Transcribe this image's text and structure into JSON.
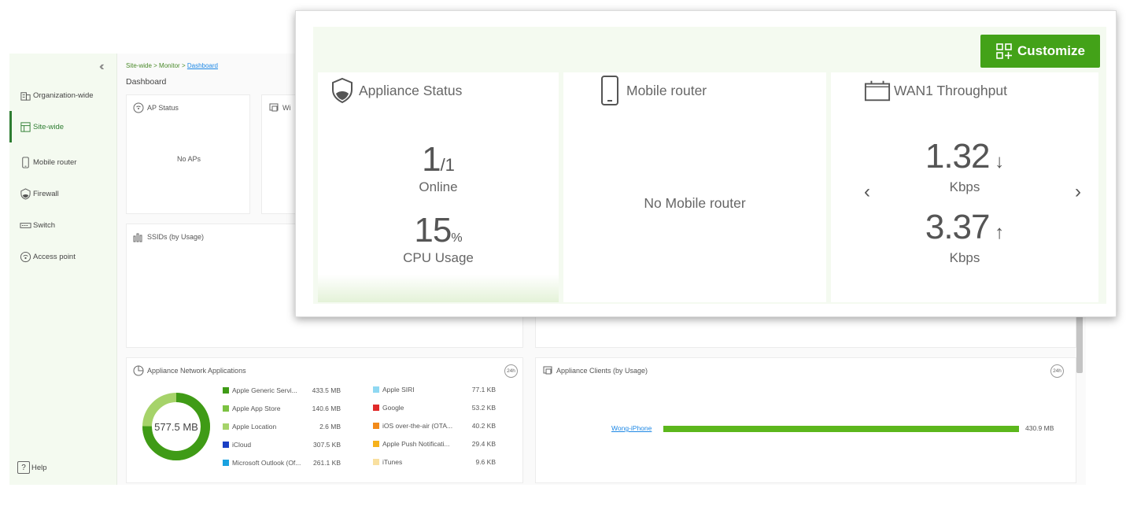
{
  "sidebar": {
    "items": [
      {
        "label": "Organization-wide",
        "icon": "organization-icon"
      },
      {
        "label": "Site-wide",
        "icon": "site-icon"
      },
      {
        "label": "Mobile router",
        "icon": "mobile-router-icon"
      },
      {
        "label": "Firewall",
        "icon": "firewall-shield-icon"
      },
      {
        "label": "Switch",
        "icon": "switch-icon"
      },
      {
        "label": "Access point",
        "icon": "access-point-icon"
      }
    ],
    "help_label": "Help"
  },
  "breadcrumb": {
    "part1": "Site-wide",
    "sep": " > ",
    "part2": "Monitor",
    "current": "Dashboard"
  },
  "page_title": "Dashboard",
  "cards": {
    "ap_status": {
      "title": "AP Status",
      "empty": "No APs"
    },
    "wireless": {
      "title": "Wi"
    },
    "ssids": {
      "title": "SSIDs (by Usage)"
    },
    "applications": {
      "title": "Appliance Network Applications",
      "badge": "24h",
      "total": "577.5 MB",
      "left": [
        {
          "name": "Apple Generic Servi...",
          "value": "433.5 MB",
          "color": "#3f9b16"
        },
        {
          "name": "Apple App Store",
          "value": "140.6 MB",
          "color": "#7cc242"
        },
        {
          "name": "Apple Location",
          "value": "2.6 MB",
          "color": "#a6d36a"
        },
        {
          "name": "iCloud",
          "value": "307.5 KB",
          "color": "#1a3fc4"
        },
        {
          "name": "Microsoft Outlook (Of...",
          "value": "261.1 KB",
          "color": "#1aa2e0"
        }
      ],
      "right": [
        {
          "name": "Apple SIRI",
          "value": "77.1 KB",
          "color": "#8fd8f2"
        },
        {
          "name": "Google",
          "value": "53.2 KB",
          "color": "#e02a2a"
        },
        {
          "name": "iOS over-the-air (OTA...",
          "value": "40.2 KB",
          "color": "#f28a1a"
        },
        {
          "name": "Apple Push Notificati...",
          "value": "29.4 KB",
          "color": "#f6b21c"
        },
        {
          "name": "iTunes",
          "value": "9.6 KB",
          "color": "#f9e0a0"
        }
      ]
    },
    "clients": {
      "title": "Appliance Clients (by Usage)",
      "badge": "24h",
      "rows": [
        {
          "name": "Wong-iPhone",
          "value": "430.9 MB",
          "fraction": 1.0
        }
      ]
    }
  },
  "overlay": {
    "customize_label": "Customize",
    "appliance_status": {
      "title": "Appliance Status",
      "online_count": "1",
      "online_total": "/1",
      "online_label": "Online",
      "cpu_value": "15",
      "cpu_unit": "%",
      "cpu_label": "CPU Usage"
    },
    "mobile_router": {
      "title": "Mobile router",
      "empty": "No Mobile router"
    },
    "wan": {
      "title": "WAN1 Throughput",
      "down_value": "1.32",
      "down_unit": "Kbps",
      "up_value": "3.37",
      "up_unit": "Kbps"
    }
  }
}
